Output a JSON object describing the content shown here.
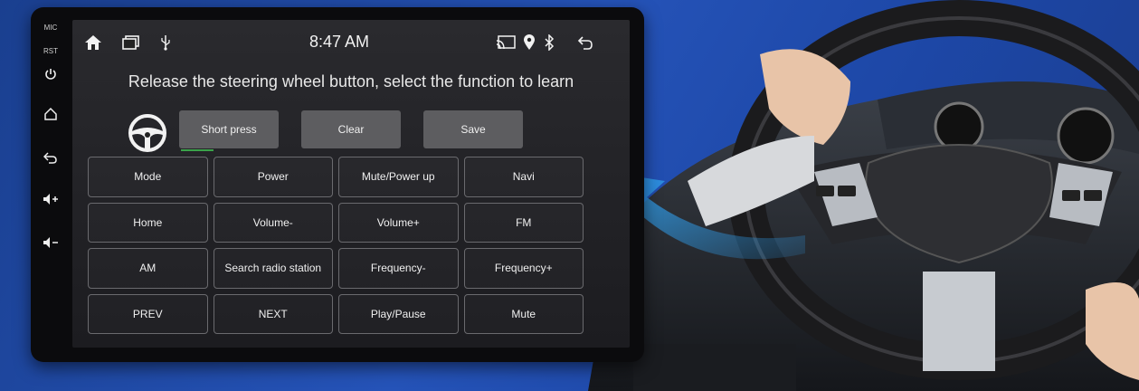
{
  "side_panel": {
    "mic_label": "MIC",
    "rst_label": "RST",
    "icons": [
      "power-icon",
      "home-icon",
      "back-icon",
      "volume-up-icon",
      "volume-down-icon"
    ]
  },
  "status_bar": {
    "time": "8:47 AM",
    "left_icons": [
      "home-icon",
      "recent-apps-icon",
      "usb-icon"
    ],
    "right_icons": [
      "screen-mirror-icon",
      "location-icon",
      "bluetooth-icon",
      "back-icon"
    ]
  },
  "prompt": "Release the steering wheel button, select the function to learn",
  "controls": {
    "short_press": "Short press",
    "clear": "Clear",
    "save": "Save",
    "active_accent": "#3aa34a"
  },
  "functions": [
    "Mode",
    "Power",
    "Mute/Power up",
    "Navi",
    "Home",
    "Volume-",
    "Volume+",
    "FM",
    "AM",
    "Search radio station",
    "Frequency-",
    "Frequency+",
    "PREV",
    "NEXT",
    "Play/Pause",
    "Mute"
  ],
  "colors": {
    "background": "#2553b8",
    "arrow": "#2f9be8",
    "button_gray": "#5d5d60"
  }
}
